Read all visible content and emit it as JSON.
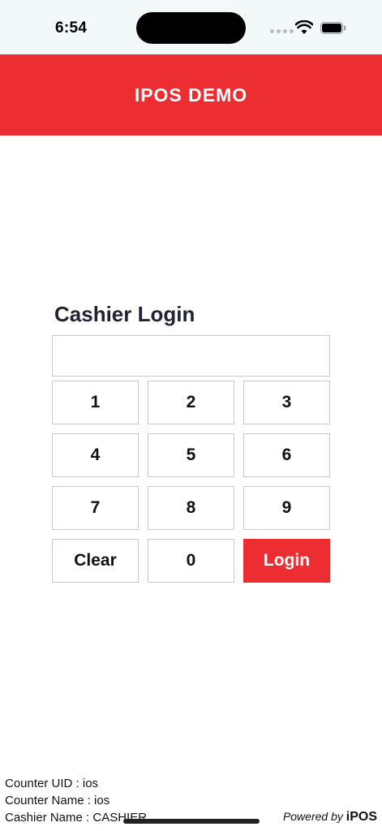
{
  "status_bar": {
    "time": "6:54"
  },
  "header": {
    "title": "IPOS DEMO",
    "color": "#ec2d32"
  },
  "login": {
    "title": "Cashier Login",
    "pin_value": "",
    "keys": [
      "1",
      "2",
      "3",
      "4",
      "5",
      "6",
      "7",
      "8",
      "9",
      "Clear",
      "0",
      "Login"
    ]
  },
  "footer": {
    "counter_uid": "Counter UID : ios",
    "counter_name": "Counter Name : ios",
    "cashier_name": "Cashier Name : CASHIER",
    "powered_by_prefix": "Powered by",
    "powered_by_brand": "iPOS"
  }
}
